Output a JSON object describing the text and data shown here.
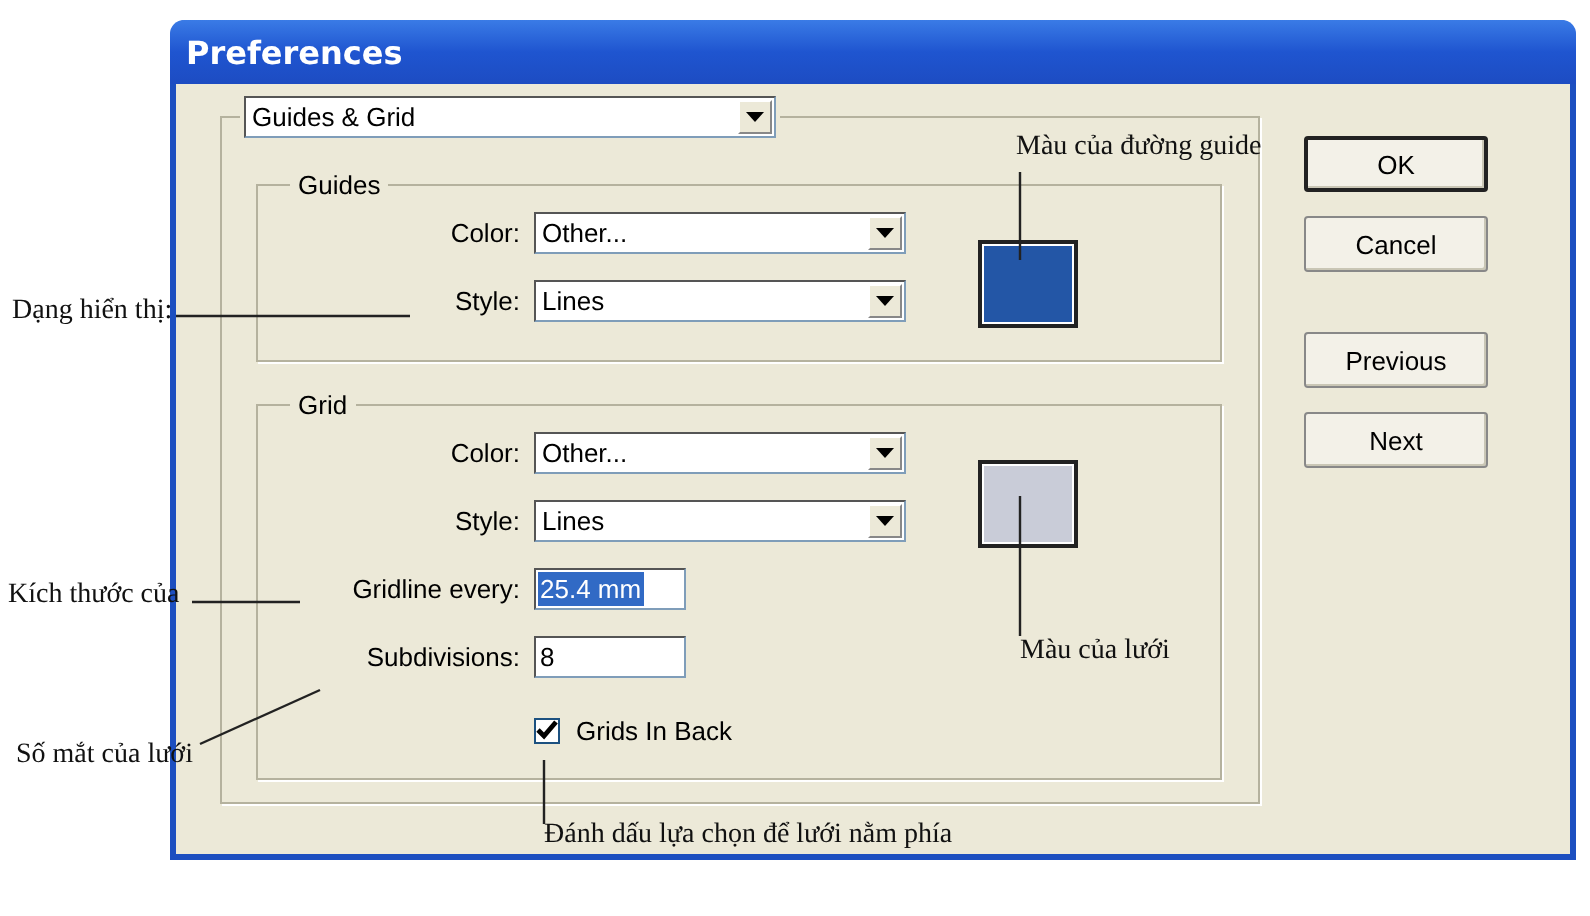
{
  "window": {
    "title": "Preferences"
  },
  "section_dropdown": {
    "value": "Guides & Grid"
  },
  "groups": [
    {
      "title": "Guides",
      "color": "#2356a6",
      "fields": [
        {
          "kind": "select",
          "label": "Color:",
          "value": "Other..."
        },
        {
          "kind": "select",
          "label": "Style:",
          "value": "Lines"
        }
      ]
    },
    {
      "title": "Grid",
      "color": "#c9ccd8",
      "fields": [
        {
          "kind": "select",
          "label": "Color:",
          "value": "Other..."
        },
        {
          "kind": "select",
          "label": "Style:",
          "value": "Lines"
        },
        {
          "kind": "text",
          "label": "Gridline every:",
          "value": "25.4 mm",
          "selected": true
        },
        {
          "kind": "text",
          "label": "Subdivisions:",
          "value": "8",
          "selected": false
        },
        {
          "kind": "checkbox",
          "label": "Grids In Back",
          "checked": true
        }
      ]
    }
  ],
  "buttons": [
    {
      "label": "OK",
      "default": true
    },
    {
      "label": "Cancel",
      "default": false
    },
    {
      "label": "Previous",
      "default": false
    },
    {
      "label": "Next",
      "default": false
    }
  ],
  "annotations": [
    {
      "text": "Màu của đường guide"
    },
    {
      "text": "Dạng hiển thị:"
    },
    {
      "text": "Kích thước của"
    },
    {
      "text": "Màu của lưới"
    },
    {
      "text": "Số mắt của lưới"
    },
    {
      "text": "Đánh dấu lựa chọn để lưới nằm phía"
    }
  ]
}
